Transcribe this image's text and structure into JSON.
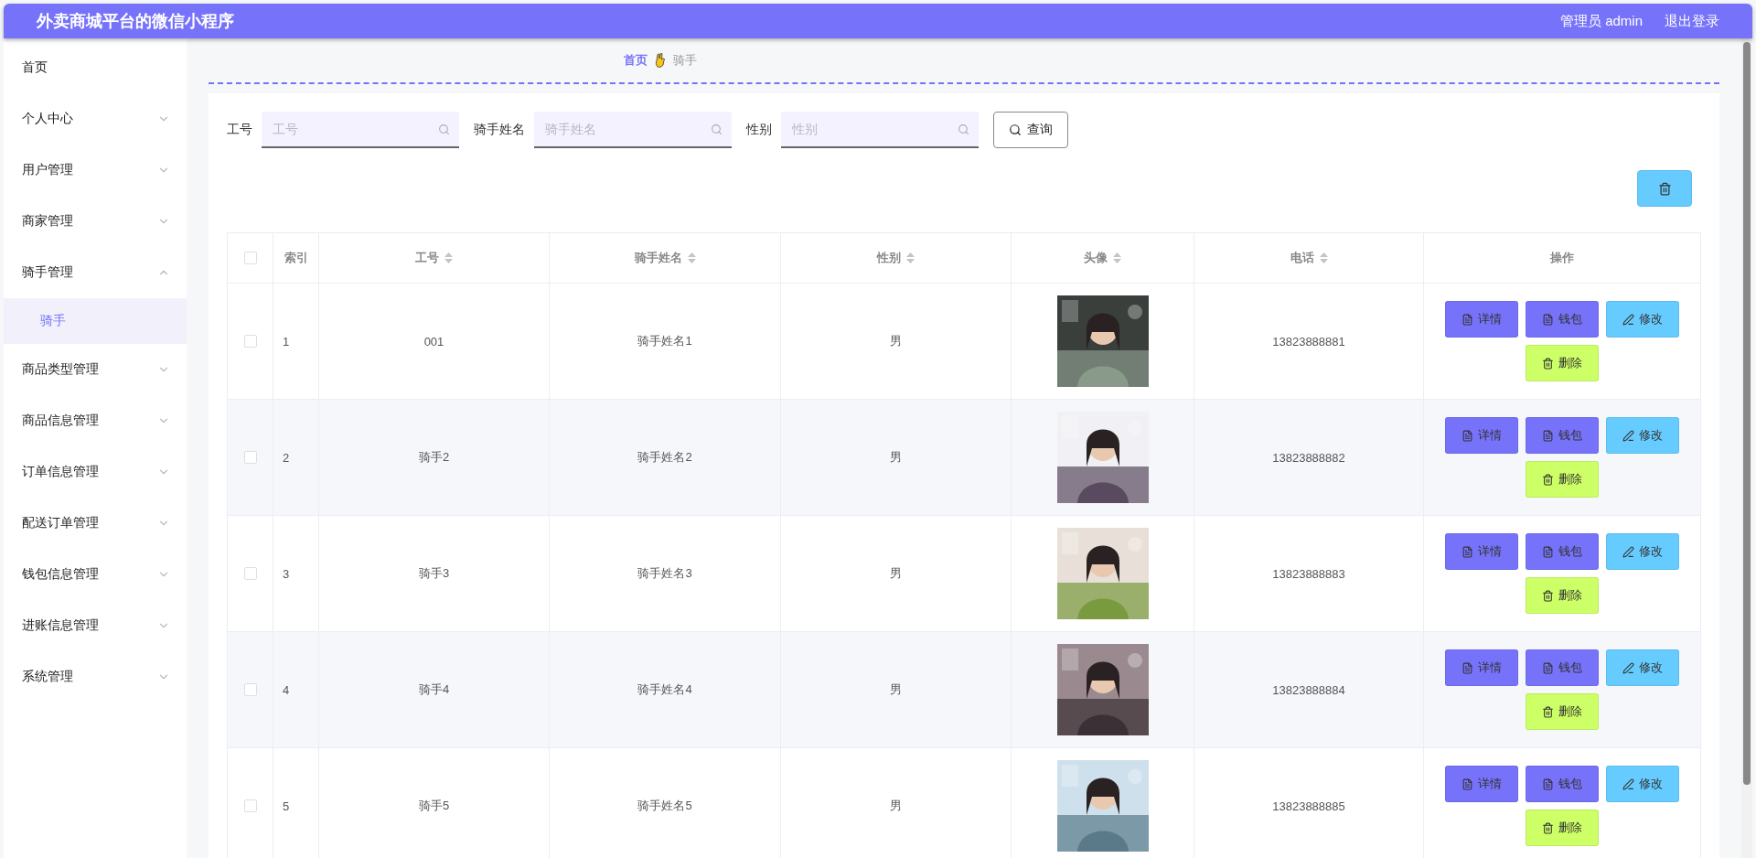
{
  "header": {
    "title": "外卖商城平台的微信小程序",
    "user": "管理员 admin",
    "logout": "退出登录"
  },
  "sidebar": {
    "items": [
      {
        "label": "首页",
        "kind": "link"
      },
      {
        "label": "个人中心",
        "kind": "group",
        "expanded": false
      },
      {
        "label": "用户管理",
        "kind": "group",
        "expanded": false
      },
      {
        "label": "商家管理",
        "kind": "group",
        "expanded": false
      },
      {
        "label": "骑手管理",
        "kind": "group",
        "expanded": true,
        "children": [
          {
            "label": "骑手",
            "selected": true
          }
        ]
      },
      {
        "label": "商品类型管理",
        "kind": "group",
        "expanded": false
      },
      {
        "label": "商品信息管理",
        "kind": "group",
        "expanded": false
      },
      {
        "label": "订单信息管理",
        "kind": "group",
        "expanded": false
      },
      {
        "label": "配送订单管理",
        "kind": "group",
        "expanded": false
      },
      {
        "label": "钱包信息管理",
        "kind": "group",
        "expanded": false
      },
      {
        "label": "进账信息管理",
        "kind": "group",
        "expanded": false
      },
      {
        "label": "系统管理",
        "kind": "group",
        "expanded": false
      }
    ]
  },
  "breadcrumb": [
    "首页",
    "骑手"
  ],
  "search": {
    "fields": [
      {
        "label": "工号",
        "placeholder": "工号"
      },
      {
        "label": "骑手姓名",
        "placeholder": "骑手姓名"
      },
      {
        "label": "性别",
        "placeholder": "性别"
      }
    ],
    "button": "查询"
  },
  "table": {
    "all_checked": false,
    "columns": [
      {
        "label": "索引",
        "sortable": false
      },
      {
        "label": "工号",
        "sortable": true
      },
      {
        "label": "骑手姓名",
        "sortable": true
      },
      {
        "label": "性别",
        "sortable": true
      },
      {
        "label": "头像",
        "sortable": true
      },
      {
        "label": "电话",
        "sortable": true
      },
      {
        "label": "操作",
        "sortable": false
      }
    ],
    "rows": [
      {
        "checked": false,
        "index": "1",
        "id": "001",
        "name": "骑手姓名1",
        "gender": "男",
        "avatar": {
          "kind": "picture"
        },
        "phone": "13823888881",
        "actions": [
          {
            "kind": "detail",
            "label": "详情"
          },
          {
            "kind": "wallet",
            "label": "钱包"
          },
          {
            "kind": "edit",
            "label": "修改"
          },
          {
            "kind": "delete",
            "label": "删除"
          }
        ]
      },
      {
        "checked": false,
        "index": "2",
        "id": "骑手2",
        "name": "骑手姓名2",
        "gender": "男",
        "avatar": {
          "kind": "picture"
        },
        "phone": "13823888882",
        "actions": [
          {
            "kind": "detail",
            "label": "详情"
          },
          {
            "kind": "wallet",
            "label": "钱包"
          },
          {
            "kind": "edit",
            "label": "修改"
          },
          {
            "kind": "delete",
            "label": "删除"
          }
        ]
      },
      {
        "checked": false,
        "index": "3",
        "id": "骑手3",
        "name": "骑手姓名3",
        "gender": "男",
        "avatar": {
          "kind": "picture"
        },
        "phone": "13823888883",
        "actions": [
          {
            "kind": "detail",
            "label": "详情"
          },
          {
            "kind": "wallet",
            "label": "钱包"
          },
          {
            "kind": "edit",
            "label": "修改"
          },
          {
            "kind": "delete",
            "label": "删除"
          }
        ]
      },
      {
        "checked": false,
        "index": "4",
        "id": "骑手4",
        "name": "骑手姓名4",
        "gender": "男",
        "avatar": {
          "kind": "picture"
        },
        "phone": "13823888884",
        "actions": [
          {
            "kind": "detail",
            "label": "详情"
          },
          {
            "kind": "wallet",
            "label": "钱包"
          },
          {
            "kind": "edit",
            "label": "修改"
          },
          {
            "kind": "delete",
            "label": "删除"
          }
        ]
      },
      {
        "checked": false,
        "index": "5",
        "id": "骑手5",
        "name": "骑手姓名5",
        "gender": "男",
        "avatar": {
          "kind": "picture"
        },
        "phone": "13823888885",
        "actions": [
          {
            "kind": "detail",
            "label": "详情"
          },
          {
            "kind": "wallet",
            "label": "钱包"
          },
          {
            "kind": "edit",
            "label": "修改"
          },
          {
            "kind": "delete",
            "label": "删除"
          }
        ]
      }
    ]
  }
}
